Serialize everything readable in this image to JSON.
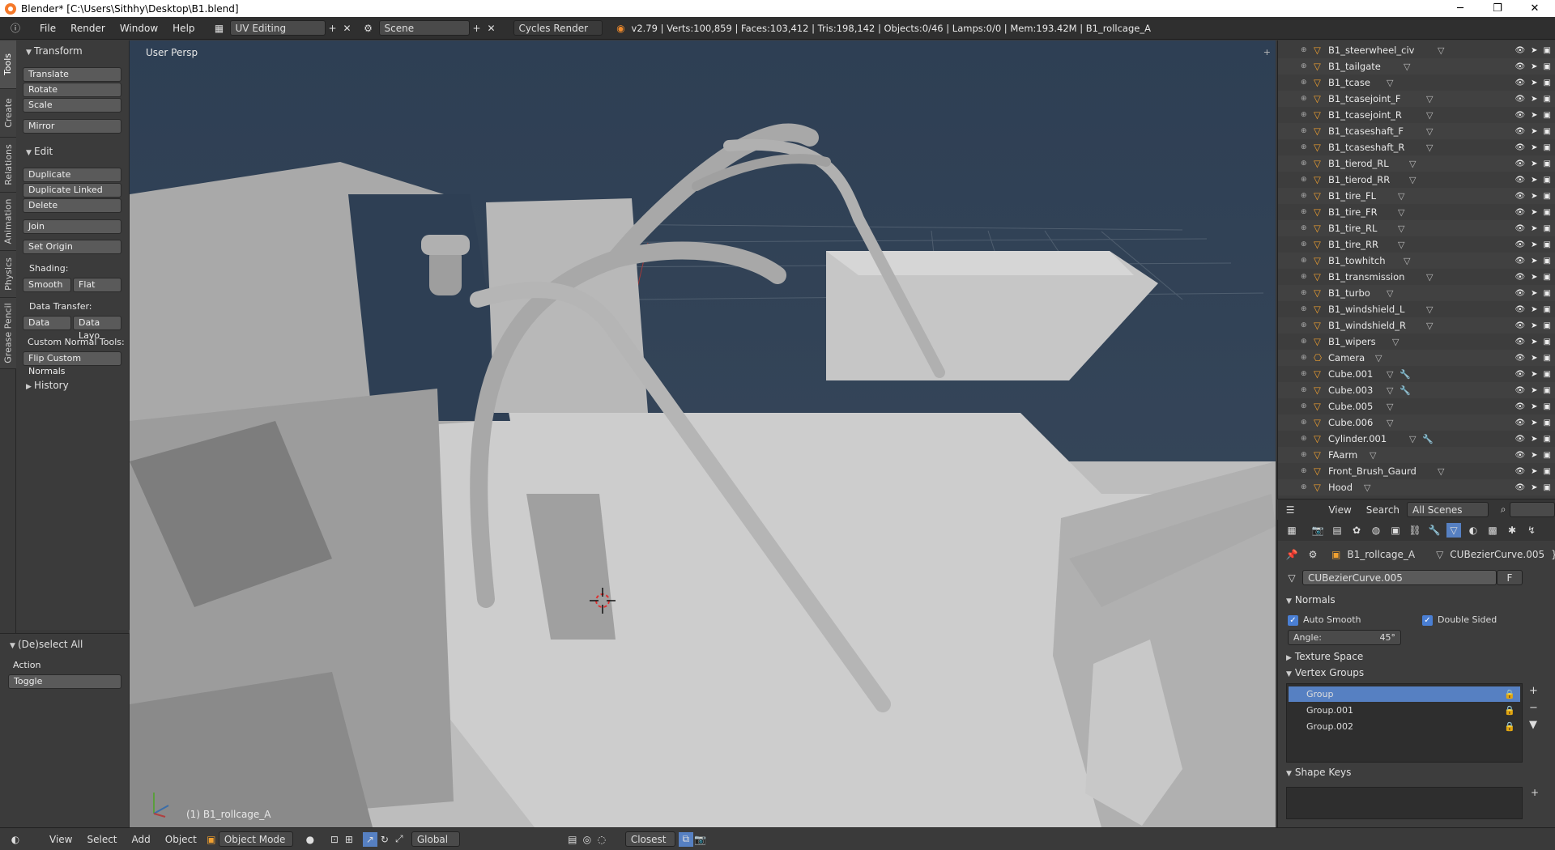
{
  "window": {
    "title": "Blender* [C:\\Users\\Sithhy\\Desktop\\B1.blend]",
    "minimize": "─",
    "maximize": "❐",
    "close": "✕"
  },
  "topbar": {
    "menus": [
      "File",
      "Render",
      "Window",
      "Help"
    ],
    "screen_layout": "UV Editing",
    "scene": "Scene",
    "engine": "Cycles Render",
    "stats": "v2.79 | Verts:100,859 | Faces:103,412 | Tris:198,142 | Objects:0/46 | Lamps:0/0 | Mem:193.42M | B1_rollcage_A"
  },
  "left_tabs": [
    "Tools",
    "Create",
    "Relations",
    "Animation",
    "Physics",
    "Grease Pencil"
  ],
  "tools": {
    "transform_header": "Transform",
    "translate": "Translate",
    "rotate": "Rotate",
    "scale": "Scale",
    "mirror": "Mirror",
    "edit_header": "Edit",
    "duplicate": "Duplicate",
    "duplicate_linked": "Duplicate Linked",
    "delete": "Delete",
    "join": "Join",
    "set_origin": "Set Origin",
    "shading_label": "Shading:",
    "smooth": "Smooth",
    "flat": "Flat",
    "data_transfer_label": "Data Transfer:",
    "data": "Data",
    "data_layo": "Data Layo",
    "custom_normal_label": "Custom Normal Tools:",
    "flip_normals": "Flip Custom Normals",
    "history_header": "History"
  },
  "operator": {
    "header": "(De)select All",
    "action_label": "Action",
    "action_value": "Toggle"
  },
  "viewport": {
    "view_label": "User Persp",
    "object_label": "(1) B1_rollcage_A"
  },
  "vp_header": {
    "view": "View",
    "select": "Select",
    "add": "Add",
    "object": "Object",
    "mode": "Object Mode",
    "orientation": "Global",
    "snap": "Closest"
  },
  "outliner": {
    "rows": [
      {
        "name": "B1_steerwheel_civ",
        "icon": "mesh"
      },
      {
        "name": "B1_tailgate",
        "icon": "mesh"
      },
      {
        "name": "B1_tcase",
        "icon": "mesh"
      },
      {
        "name": "B1_tcasejoint_F",
        "icon": "mesh"
      },
      {
        "name": "B1_tcasejoint_R",
        "icon": "mesh"
      },
      {
        "name": "B1_tcaseshaft_F",
        "icon": "mesh"
      },
      {
        "name": "B1_tcaseshaft_R",
        "icon": "mesh"
      },
      {
        "name": "B1_tierod_RL",
        "icon": "mesh"
      },
      {
        "name": "B1_tierod_RR",
        "icon": "mesh"
      },
      {
        "name": "B1_tire_FL",
        "icon": "mesh"
      },
      {
        "name": "B1_tire_FR",
        "icon": "mesh"
      },
      {
        "name": "B1_tire_RL",
        "icon": "mesh"
      },
      {
        "name": "B1_tire_RR",
        "icon": "mesh"
      },
      {
        "name": "B1_towhitch",
        "icon": "mesh"
      },
      {
        "name": "B1_transmission",
        "icon": "mesh"
      },
      {
        "name": "B1_turbo",
        "icon": "mesh"
      },
      {
        "name": "B1_windshield_L",
        "icon": "mesh"
      },
      {
        "name": "B1_windshield_R",
        "icon": "mesh"
      },
      {
        "name": "B1_wipers",
        "icon": "mesh"
      },
      {
        "name": "Camera",
        "icon": "camera"
      },
      {
        "name": "Cube.001",
        "icon": "mesh-wrench"
      },
      {
        "name": "Cube.003",
        "icon": "mesh-wrench"
      },
      {
        "name": "Cube.005",
        "icon": "mesh"
      },
      {
        "name": "Cube.006",
        "icon": "mesh"
      },
      {
        "name": "Cylinder.001",
        "icon": "mesh-wrench"
      },
      {
        "name": "FAarm",
        "icon": "mesh"
      },
      {
        "name": "Front_Brush_Gaurd",
        "icon": "mesh"
      },
      {
        "name": "Hood",
        "icon": "mesh"
      }
    ],
    "header": {
      "view": "View",
      "search": "Search",
      "filter": "All Scenes"
    }
  },
  "properties": {
    "object_name": "B1_rollcage_A",
    "data_name": "CUBezierCurve.005",
    "datablock": "CUBezierCurve.005",
    "fake_user": "F",
    "normals_header": "Normals",
    "auto_smooth": "Auto Smooth",
    "double_sided": "Double Sided",
    "angle_label": "Angle:",
    "angle_value": "45°",
    "texture_space": "Texture Space",
    "vertex_groups_header": "Vertex Groups",
    "vertex_groups": [
      "Group",
      "Group.001",
      "Group.002"
    ],
    "shape_keys": "Shape Keys"
  },
  "colors": {
    "accent": "#5680c2",
    "viewport_bg_top": "#2e3f54",
    "viewport_bg_bottom": "#3a4a5c",
    "mesh": "#c8c8c8"
  }
}
